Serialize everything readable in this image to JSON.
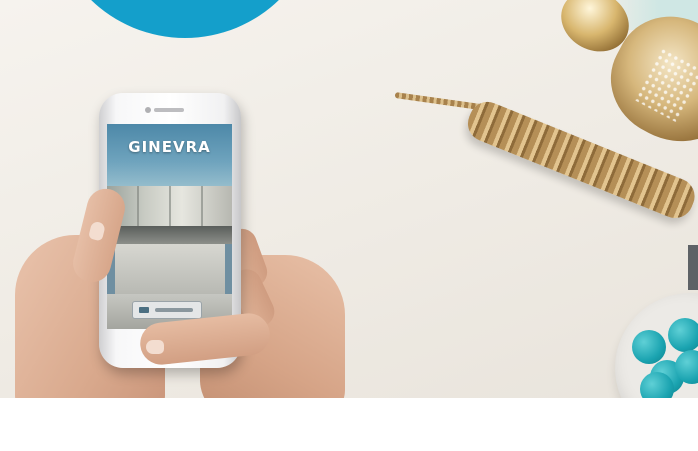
{
  "phone_screen": {
    "brand": "GINEVRA"
  },
  "colors": {
    "accent_circle": "#149fcb",
    "background": "#f2efe9",
    "gold": "#c9a463",
    "teal": "#1aa3b0"
  },
  "icons": [
    "blue-circle-shape",
    "gold-chain",
    "perfume-bottle",
    "confetti-bowl",
    "smartphone"
  ]
}
